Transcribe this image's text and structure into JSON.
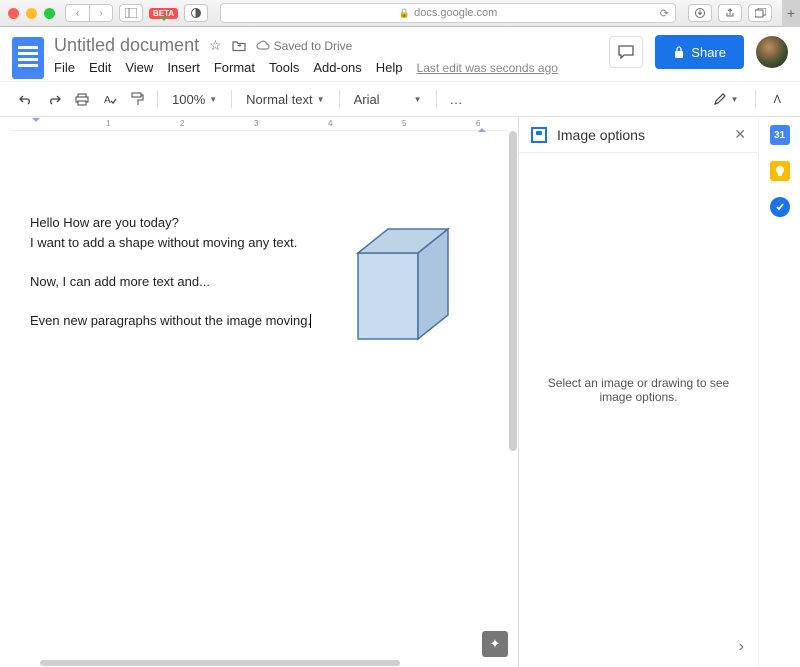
{
  "browser": {
    "url": "docs.google.com",
    "beta_label": "BETA"
  },
  "header": {
    "doc_title": "Untitled document",
    "save_status": "Saved to Drive",
    "last_edit": "Last edit was seconds ago",
    "share_label": "Share"
  },
  "menubar": {
    "file": "File",
    "edit": "Edit",
    "view": "View",
    "insert": "Insert",
    "format": "Format",
    "tools": "Tools",
    "addons": "Add-ons",
    "help": "Help"
  },
  "toolbar": {
    "zoom": "100%",
    "style": "Normal text",
    "font": "Arial"
  },
  "ruler": [
    "1",
    "2",
    "3",
    "4",
    "5",
    "6"
  ],
  "document": {
    "line1": "Hello How are you today?",
    "line2": "I want to add a shape without moving any text.",
    "line3": "Now, I can add more text and...",
    "line4": "Even new paragraphs without the image moving."
  },
  "sidepanel": {
    "title": "Image options",
    "empty_msg": "Select an image or drawing to see image options."
  },
  "rail": {
    "calendar": "31"
  }
}
